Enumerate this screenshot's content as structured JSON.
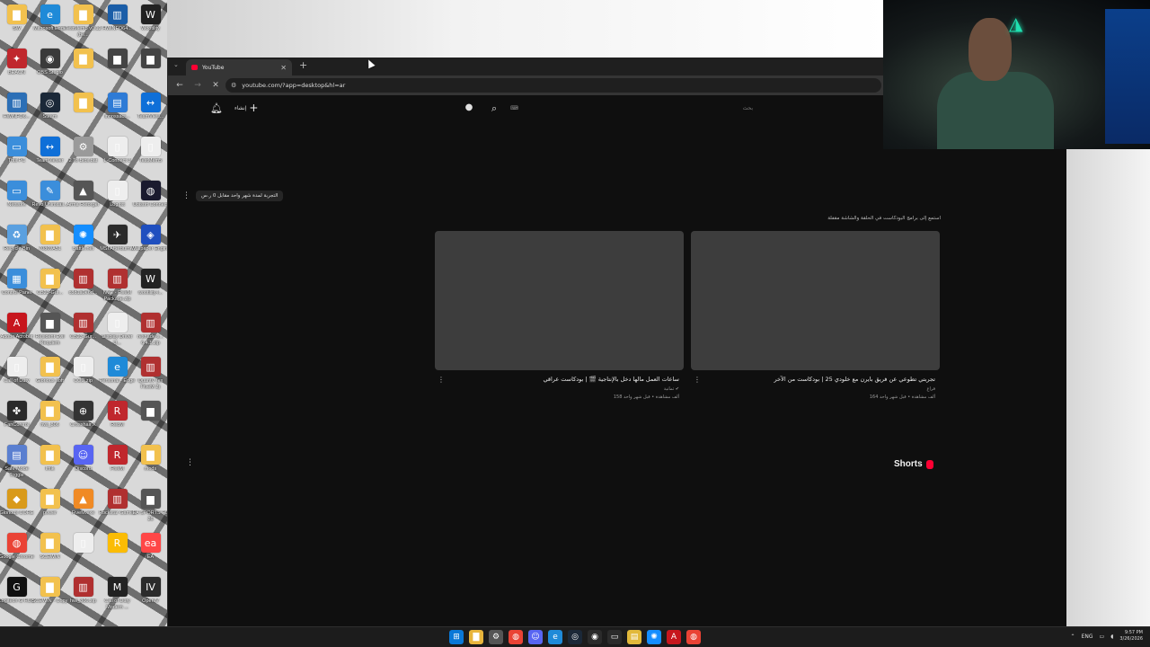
{
  "desktop": {
    "icons": [
      {
        "label": "SW",
        "color": "#f2c14e",
        "glyph": "▇"
      },
      {
        "label": "Microsoft Edge",
        "color": "#1f8ad8",
        "glyph": "e"
      },
      {
        "label": "TestMem5 v0.12 (be...",
        "color": "#f2c14e",
        "glyph": "▇"
      },
      {
        "label": "HWiNFO64...",
        "color": "#1b5ea8",
        "glyph": "▥"
      },
      {
        "label": "Wootility",
        "color": "#222222",
        "glyph": "W"
      },
      {
        "label": "BEACN",
        "color": "#c0272d",
        "glyph": "✦"
      },
      {
        "label": "OBS Studio",
        "color": "#3a3a3a",
        "glyph": "◉"
      },
      {
        "label": "",
        "color": "#f2c14e",
        "glyph": "▇"
      },
      {
        "label": "",
        "color": "#444444",
        "glyph": "▆"
      },
      {
        "label": "",
        "color": "#444444",
        "glyph": "▆"
      },
      {
        "label": "HWiNFO6...",
        "color": "#2c6fb6",
        "glyph": "▥"
      },
      {
        "label": "Steam",
        "color": "#1b2838",
        "glyph": "◎"
      },
      {
        "label": "",
        "color": "#f2c14e",
        "glyph": "▇"
      },
      {
        "label": "innossact...",
        "color": "#2e7bd6",
        "glyph": "▤"
      },
      {
        "label": "TeamView...",
        "color": "#0e6fd8",
        "glyph": "↔"
      },
      {
        "label": "This PC",
        "color": "#3b8edb",
        "glyph": "▭"
      },
      {
        "label": "TeamViewer",
        "color": "#0e6fd8",
        "glyph": "↔"
      },
      {
        "label": "2 To Bios.bat",
        "color": "#9a9a9a",
        "glyph": "⚙"
      },
      {
        "label": "L-Connect 3",
        "color": "#eeeeee",
        "glyph": "▯"
      },
      {
        "label": "TestMem5",
        "color": "#eeeeee",
        "glyph": "▯"
      },
      {
        "label": "Network",
        "color": "#3b8edb",
        "glyph": "▭"
      },
      {
        "label": "Revo Uninstall...",
        "color": "#3b8edb",
        "glyph": "✎"
      },
      {
        "label": "Arma Reforger",
        "color": "#555555",
        "glyph": "▲"
      },
      {
        "label": "Log.txt",
        "color": "#eeeeee",
        "glyph": "▯"
      },
      {
        "label": "Ubisoft Connect",
        "color": "#1a1a2e",
        "glyph": "◍"
      },
      {
        "label": "Recycle Bin",
        "color": "#5aa0e0",
        "glyph": "♻"
      },
      {
        "label": "7086vA51",
        "color": "#f2c14e",
        "glyph": "▇"
      },
      {
        "label": "Battle.net",
        "color": "#148eff",
        "glyph": "✺"
      },
      {
        "label": "MSI Afterburner",
        "color": "#2b2b2b",
        "glyph": "✈"
      },
      {
        "label": "Wallpaper Engine",
        "color": "#1f4fbf",
        "glyph": "◈"
      },
      {
        "label": "Control Panel",
        "color": "#3b8edb",
        "glyph": "▦"
      },
      {
        "label": "CB23-Gur...",
        "color": "#f2c14e",
        "glyph": "▇"
      },
      {
        "label": "c8d1a0e6d...",
        "color": "#b03030",
        "glyph": "▥"
      },
      {
        "label": "NVE - FiveM Package.zip",
        "color": "#b03030",
        "glyph": "▥"
      },
      {
        "label": "wootility-l...",
        "color": "#222222",
        "glyph": "W"
      },
      {
        "label": "Adobe Acrobat",
        "color": "#c7161d",
        "glyph": "A"
      },
      {
        "label": "Resident Evil Requiem",
        "color": "#555555",
        "glyph": "▆"
      },
      {
        "label": "CB23-Gur...",
        "color": "#b03030",
        "glyph": "▥"
      },
      {
        "label": "Display Driver U...",
        "color": "#eeeeee",
        "glyph": "▯"
      },
      {
        "label": "reshade-s... 6.4.1.zip",
        "color": "#b03030",
        "glyph": "▥"
      },
      {
        "label": "Call of Duty",
        "color": "#eeeeee",
        "glyph": "▯"
      },
      {
        "label": "Glorious soft",
        "color": "#f2c14e",
        "glyph": "▇"
      },
      {
        "label": "COD.zip",
        "color": "#eeeeee",
        "glyph": "▯"
      },
      {
        "label": "Personal - Edge",
        "color": "#1f8ad8",
        "glyph": "e"
      },
      {
        "label": "QuantV (ex FiveM 2)",
        "color": "#b03030",
        "glyph": "▥"
      },
      {
        "label": "FanControl",
        "color": "#2a2a2a",
        "glyph": "✤"
      },
      {
        "label": "hwi_806",
        "color": "#f2c14e",
        "glyph": "▇"
      },
      {
        "label": "Crosshair X",
        "color": "#333333",
        "glyph": "⊕"
      },
      {
        "label": "RedM",
        "color": "#c0272d",
        "glyph": "R"
      },
      {
        "label": "",
        "color": "#555555",
        "glyph": "▆"
      },
      {
        "label": "Safe Mode Toggle",
        "color": "#5a7fd0",
        "glyph": "▤"
      },
      {
        "label": "Imik",
        "color": "#f2c14e",
        "glyph": "▇"
      },
      {
        "label": "Discord",
        "color": "#5865f2",
        "glyph": "☺"
      },
      {
        "label": "FiveM",
        "color": "#c0272d",
        "glyph": "R"
      },
      {
        "label": "mods",
        "color": "#f2c14e",
        "glyph": "▇"
      },
      {
        "label": "Glorious CORE",
        "color": "#d99a1a",
        "glyph": "◆"
      },
      {
        "label": "power",
        "color": "#f2c14e",
        "glyph": "▇"
      },
      {
        "label": "FiveM.exe",
        "color": "#f08a24",
        "glyph": "▲"
      },
      {
        "label": "Rockstar Games",
        "color": "#b03030",
        "glyph": "▥"
      },
      {
        "label": "EA SPORTS FC 26",
        "color": "#555555",
        "glyph": "▆"
      },
      {
        "label": "Google Chrome",
        "color": "#ea4335",
        "glyph": "◍"
      },
      {
        "label": "SCEWIN",
        "color": "#f2c14e",
        "glyph": "▇"
      },
      {
        "label": "",
        "color": "#eeeeee",
        "glyph": "▯"
      },
      {
        "label": "",
        "color": "#fbbc05",
        "glyph": "R"
      },
      {
        "label": "EA",
        "color": "#ff4747",
        "glyph": "ea"
      },
      {
        "label": "Logitech G HUB",
        "color": "#111111",
        "glyph": "G"
      },
      {
        "label": "SCEWIN - Copy",
        "color": "#f2c14e",
        "glyph": "▇"
      },
      {
        "label": "hwi_806.zip",
        "color": "#b03030",
        "glyph": "▥"
      },
      {
        "label": "Call of Duty Modern ...",
        "color": "#222222",
        "glyph": "M"
      },
      {
        "label": "OpenIV",
        "color": "#2b2b2b",
        "glyph": "IV"
      }
    ]
  },
  "browser": {
    "tab_title": "YouTube",
    "tab_close": "✕",
    "new_tab": "+",
    "tab_menu": "⌄",
    "back": "←",
    "forward": "→",
    "reload": "✕",
    "site_info": "⚙",
    "url": "youtube.com/?app=desktop&hl=ar"
  },
  "youtube": {
    "create_label": "إنشاء",
    "search_placeholder": "بحث",
    "keyboard_icon": "⌨",
    "chip_more": "⋮",
    "chip_label": "التجربة لمدة شهر واحد مقابل 0 ر.س",
    "section_title": "استمع إلى برامج البودكاست في الحلقة والشاشة مقفلة",
    "videos": [
      {
        "title": "ساعات العمل مالها دخل بالإنتاجية 🎬 | بودكاست عراقي",
        "channel": "ثمانية ✔",
        "stats": "158 ألف مشاهدة • قبل شهر واحد"
      },
      {
        "title": "تجربتي تطوعي عن فريق بايرن مع خلودي 25 | بودكاست من الآخر",
        "channel": "فراغ",
        "stats": "164 ألف مشاهدة • قبل شهر واحد"
      }
    ],
    "shorts_label": "Shorts",
    "shorts_more": "⋮"
  },
  "taskbar": {
    "icons": [
      {
        "name": "windows-start",
        "color": "#0a78d7",
        "glyph": "⊞"
      },
      {
        "name": "file-explorer",
        "color": "#e8b53c",
        "glyph": "▇"
      },
      {
        "name": "settings",
        "color": "#555555",
        "glyph": "⚙"
      },
      {
        "name": "chrome",
        "color": "#ea4335",
        "glyph": "◍"
      },
      {
        "name": "discord",
        "color": "#5865f2",
        "glyph": "☺"
      },
      {
        "name": "edge",
        "color": "#1f8ad8",
        "glyph": "e"
      },
      {
        "name": "steam",
        "color": "#1b2838",
        "glyph": "◎"
      },
      {
        "name": "obs",
        "color": "#2b2b2b",
        "glyph": "◉"
      },
      {
        "name": "terminal",
        "color": "#2b2b2b",
        "glyph": "▭"
      },
      {
        "name": "notes",
        "color": "#e2b93b",
        "glyph": "▤"
      },
      {
        "name": "battle-net",
        "color": "#148eff",
        "glyph": "✺"
      },
      {
        "name": "adobe",
        "color": "#c7161d",
        "glyph": "A"
      },
      {
        "name": "chrome-active",
        "color": "#ea4335",
        "glyph": "◍"
      }
    ],
    "tray_chevron": "⌃",
    "tray_lang": "ENG",
    "clock_time": "9:57 PM",
    "clock_date": "3/26/2026"
  }
}
